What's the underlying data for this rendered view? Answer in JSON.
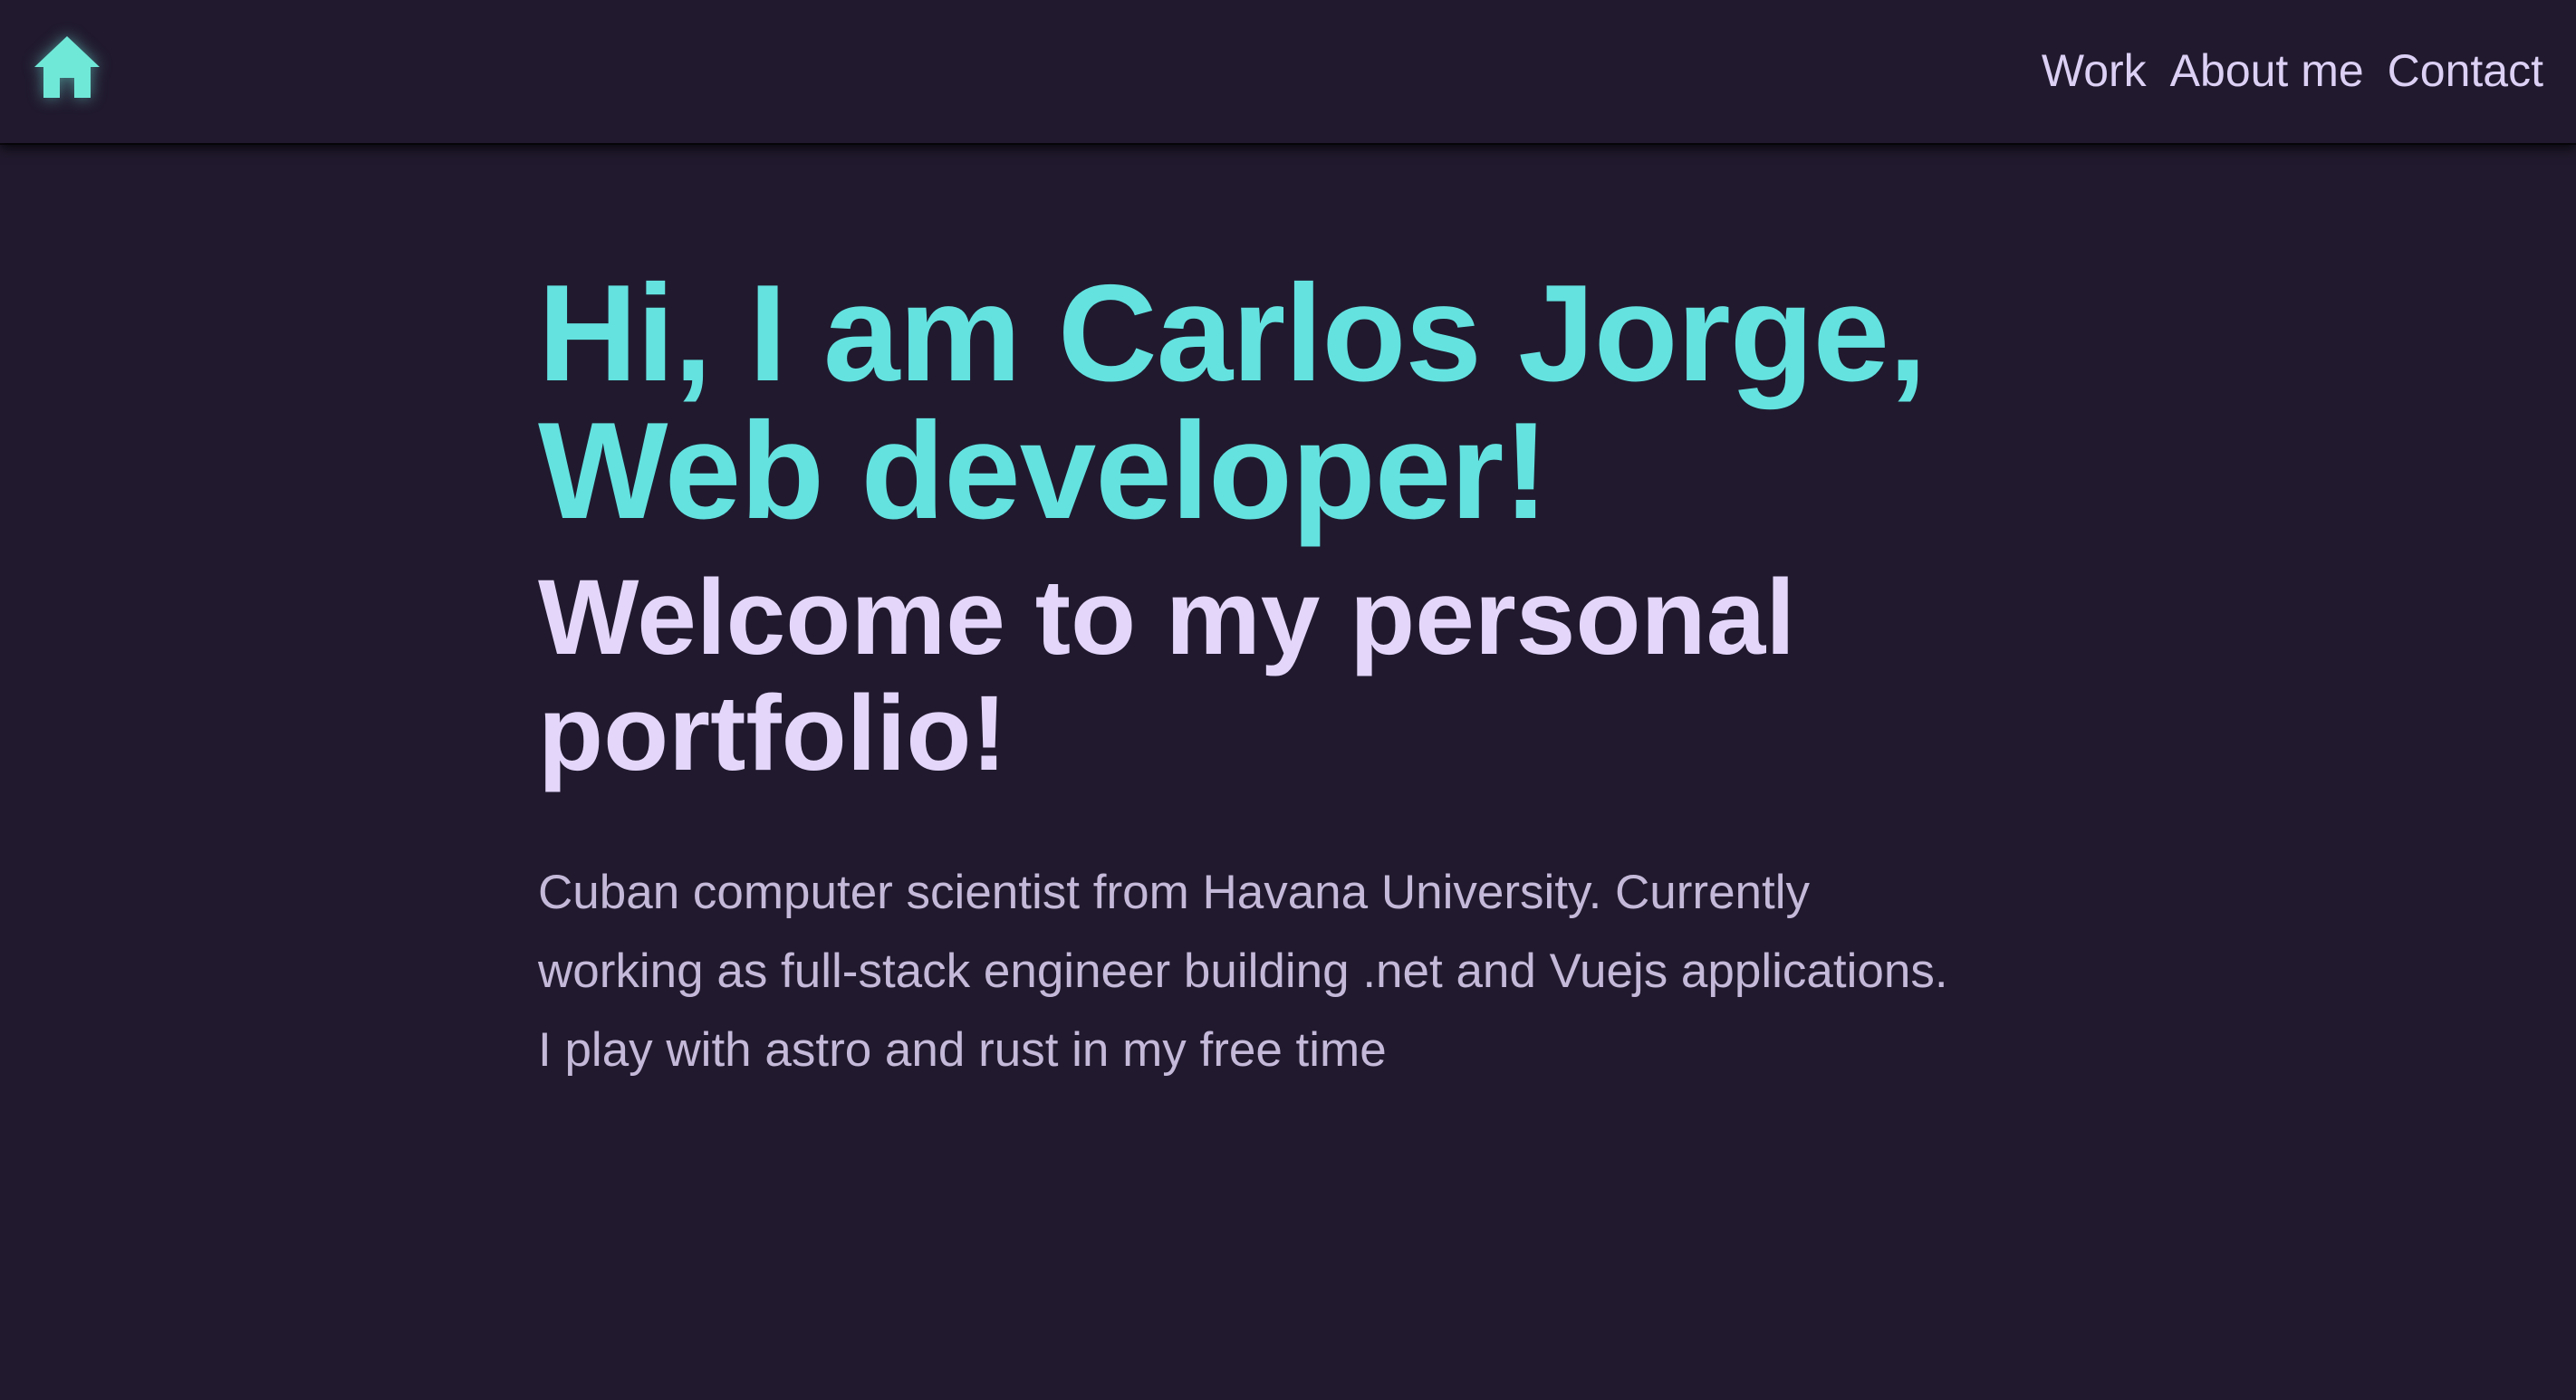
{
  "nav": {
    "home_icon": "home-icon",
    "links": [
      {
        "label": "Work"
      },
      {
        "label": "About me"
      },
      {
        "label": "Contact"
      }
    ]
  },
  "hero": {
    "title_line1": "Hi, I am Carlos Jorge,",
    "title_line2": "Web developer!",
    "subtitle_line1": "Welcome to my personal",
    "subtitle_line2": "portfolio!",
    "description_line1": "Cuban computer scientist from Havana University. Currently",
    "description_line2": "working as full-stack engineer building .net and Vuejs applications.",
    "description_line3": "I play with astro and rust in my free time"
  },
  "colors": {
    "background": "#211a2e",
    "accent": "#63e2e0",
    "heading": "#e3d6fa",
    "nav_text": "#dcd0f5",
    "body_text": "#c5b9d9",
    "icon": "#70e8d8"
  }
}
